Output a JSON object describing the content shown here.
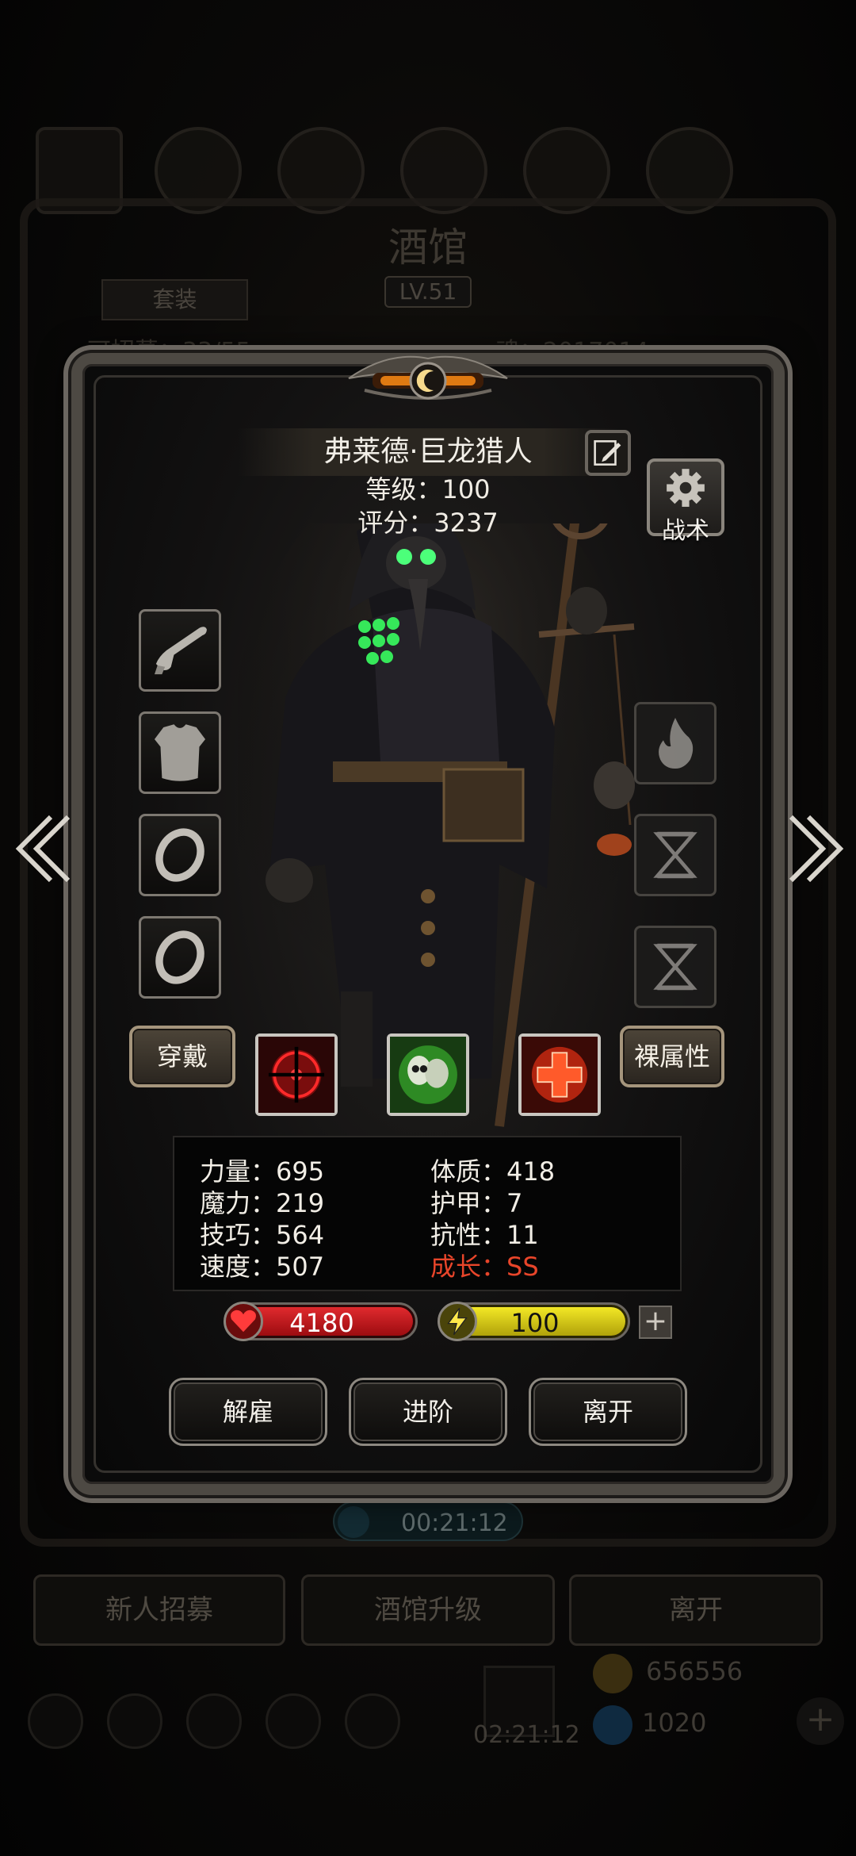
{
  "background": {
    "title": "酒馆",
    "level": "LV.51",
    "suit_tab": "套装",
    "count": "可招募：33/55",
    "soul": "魂：2017014",
    "timer": "00:21:12",
    "buttons": [
      "新人招募",
      "酒馆升级",
      "离开"
    ],
    "gift_timer": "02:21:12",
    "gold": "656556",
    "gems": "1020"
  },
  "hero": {
    "name": "弗莱德·巨龙猎人",
    "level_label": "等级：100",
    "score_label": "评分：3237"
  },
  "tactic_button": "战术",
  "equip_left": [
    {
      "name": "pistol-slot",
      "icon": "pistol-icon"
    },
    {
      "name": "armor-slot",
      "icon": "armor-icon"
    },
    {
      "name": "ring-slot-1",
      "icon": "ring-icon"
    },
    {
      "name": "ring-slot-2",
      "icon": "ring-icon"
    }
  ],
  "equip_right": [
    {
      "name": "fire-rune-slot",
      "icon": "flame-icon"
    },
    {
      "name": "hourglass-rune-slot-1",
      "icon": "hourglass-icon"
    },
    {
      "name": "hourglass-rune-slot-2",
      "icon": "hourglass-icon"
    }
  ],
  "action_row": {
    "wear_button": "穿戴",
    "bare_attr_button": "裸属性",
    "skills": [
      "crosshair-skill-icon",
      "skull-skill-icon",
      "healing-cross-skill-icon"
    ]
  },
  "stats": {
    "left": [
      "力量：695",
      "魔力：219",
      "技巧：564",
      "速度：507"
    ],
    "right": [
      "体质：418",
      "护甲：7",
      "抗性：11"
    ],
    "growth": "成长：SS"
  },
  "bars": {
    "hp": "4180",
    "energy": "100",
    "hp_color": "#c7141a",
    "energy_color": "#d9cc14"
  },
  "modal_buttons": [
    "解雇",
    "进阶",
    "离开"
  ]
}
